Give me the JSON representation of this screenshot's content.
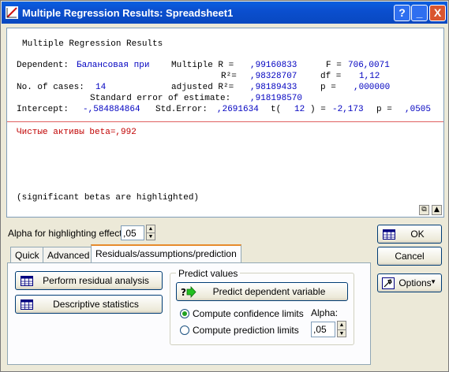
{
  "window": {
    "title": "Multiple Regression Results: Spreadsheet1"
  },
  "titlebar_buttons": {
    "help": "?",
    "minimize": "_",
    "close": "X"
  },
  "results": {
    "heading": "Multiple Regression Results",
    "dependent_label": "Dependent:",
    "dependent_value": "Балансовая при",
    "multiple_r_label": "Multiple R =",
    "multiple_r": ",99160833",
    "f_label": "F =",
    "f_value": "706,0071",
    "r2_label": "R²=",
    "r2": ",98328707",
    "df_label": "df =",
    "df_value": "1,12",
    "cases_label": "No. of cases:",
    "cases_value": "14",
    "adj_r2_label": "adjusted R²=",
    "adj_r2": ",98189433",
    "p_label": "p =",
    "p_value": ",000000",
    "se_label": "Standard error of estimate:",
    "se_value": ",918198570",
    "intercept_label": "Intercept:",
    "intercept_value": "-,584884864",
    "stderr_label": "Std.Error:",
    "stderr_value": ",2691634",
    "t_label": "t(",
    "t_df": "12",
    "t_close": ") =",
    "t_value": "-2,173",
    "p2_label": "p =",
    "p2_value": ",0505",
    "beta_line": "Чистые активы beta=,992",
    "note": "(significant betas are highlighted)"
  },
  "alpha_highlight": {
    "label": "Alpha for highlighting effects:",
    "value": ",05"
  },
  "tabs": [
    "Quick",
    "Advanced",
    "Residuals/assumptions/prediction"
  ],
  "buttons": {
    "residual": "Perform residual analysis",
    "descriptive": "Descriptive statistics",
    "predict": "Predict dependent variable",
    "ok": "OK",
    "cancel": "Cancel",
    "options": "Options"
  },
  "predict_group": {
    "title": "Predict values",
    "confidence": "Compute confidence limits",
    "prediction": "Compute prediction limits",
    "alpha_label": "Alpha:",
    "alpha_value": ",05"
  },
  "colors": {
    "title_bar": "#0b4fcf",
    "blue_text": "#0000c0",
    "red_text": "#c00000",
    "tab_accent": "#e68b2c"
  }
}
